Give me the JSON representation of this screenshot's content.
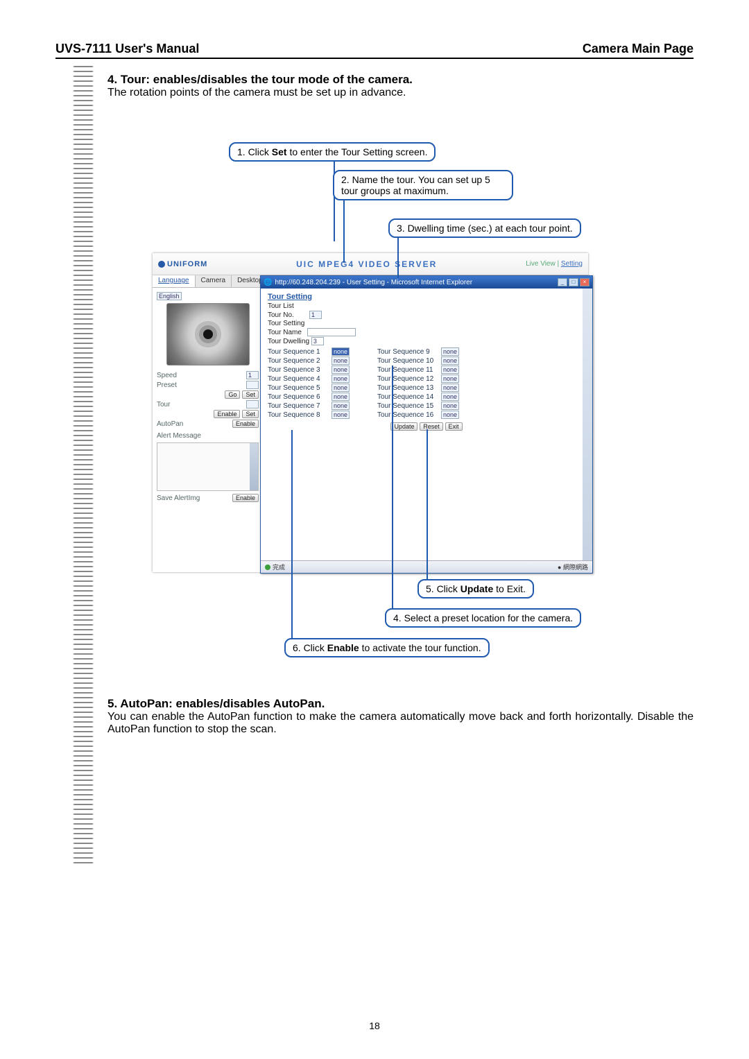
{
  "header": {
    "left": "UVS-7111 User's Manual",
    "right": "Camera Main Page"
  },
  "section4": {
    "title": "4. Tour: enables/disables the tour mode of the camera.",
    "body": "The rotation points of the camera must be set up in advance."
  },
  "callouts": {
    "c1": {
      "pre": "1. Click ",
      "bold": "Set",
      "post": " to enter the Tour Setting screen."
    },
    "c2": "2. Name the tour. You can set up 5 tour groups at maximum.",
    "c3": "3. Dwelling time (sec.) at each tour point.",
    "c4": "4. Select a preset location for the camera.",
    "c5": {
      "pre": "5. Click ",
      "bold": "Update",
      "post": " to Exit."
    },
    "c6": {
      "pre": "6. Click ",
      "bold": "Enable",
      "post": " to activate the tour function."
    }
  },
  "scr": {
    "brand": "UNIFORM",
    "bannerTitle": "UIC MPEG4 VIDEO SERVER",
    "liveView": "Live View",
    "setting": "Setting",
    "tabs": {
      "language": "Language",
      "camera": "Camera",
      "desktop": "Desktop"
    },
    "lang": "English",
    "left": {
      "speed": "Speed",
      "speedVal": "1",
      "preset": "Preset",
      "go": "Go",
      "set": "Set",
      "tour": "Tour",
      "enable": "Enable",
      "autopan": "AutoPan",
      "alert": "Alert Message",
      "save": "Save AlertImg"
    },
    "ie": {
      "title": "http://60.248.204.239 - User Setting - Microsoft Internet Explorer",
      "heading": "Tour Setting",
      "tourList": "Tour List",
      "tourNo": "Tour No.",
      "tourNoVal": "1",
      "tourSetting": "Tour Setting",
      "tourName": "Tour Name",
      "tourDwelling": "Tour Dwelling",
      "tourDwellingVal": "3",
      "none": "none",
      "seqLeft": [
        "Tour Sequence 1",
        "Tour Sequence 2",
        "Tour Sequence 3",
        "Tour Sequence 4",
        "Tour Sequence 5",
        "Tour Sequence 6",
        "Tour Sequence 7",
        "Tour Sequence 8"
      ],
      "seqRight": [
        "Tour Sequence 9",
        "Tour Sequence 10",
        "Tour Sequence 11",
        "Tour Sequence 12",
        "Tour Sequence 13",
        "Tour Sequence 14",
        "Tour Sequence 15",
        "Tour Sequence 16"
      ],
      "update": "Update",
      "reset": "Reset",
      "exit": "Exit",
      "statusLeft": "完成",
      "statusRight": "網際網路"
    }
  },
  "section5": {
    "title": "5. AutoPan: enables/disables AutoPan.",
    "body": "You can enable the AutoPan function to make the camera automatically move back and forth horizontally. Disable the AutoPan function to stop the scan."
  },
  "pageNumber": "18"
}
